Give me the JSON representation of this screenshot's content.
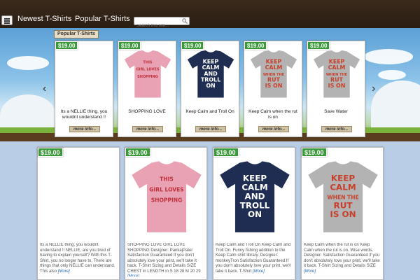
{
  "header": {
    "nav": [
      "Newest T-Shirts",
      "Popular T-Shirts"
    ],
    "search_placeholder": "Search this site..."
  },
  "slider": {
    "tag": "Popular T-Shirts",
    "prev": "‹",
    "next": "›",
    "items": [
      {
        "price": "$19.00",
        "title": "Its a NELLIE thing, you wouldnt understand !!",
        "more": "more info...",
        "shirt": "none"
      },
      {
        "price": "$19.00",
        "title": "SHOPPING LOVE",
        "more": "more info...",
        "shirt": "pink"
      },
      {
        "price": "$19.00",
        "title": "Keep Calm and Troll On",
        "more": "more info...",
        "shirt": "navy"
      },
      {
        "price": "$19.00",
        "title": "Keep Calm when the rut is on",
        "more": "more info...",
        "shirt": "grey"
      },
      {
        "price": "$19.00",
        "title": "Save Water",
        "more": "more info...",
        "shirt": "grey"
      }
    ]
  },
  "grid": [
    {
      "price": "$19.00",
      "desc": "Its a NELLIE thing, you wouldnt understand !! NELLIE, are you tired of having to explain yourself? With this T-Shirt, you no longer have to. There are things that only NELLIE can understand. This also",
      "more": "[More]",
      "shirt": "none"
    },
    {
      "price": "$19.00",
      "desc": "SHOPPING LOVE GIRL LOVE SHOPPING Designer: PankajPatel Satisfaction Guaranteed If you don't absolutely love your print, we'll take it back. T-Shirt Sizing and Details SIZE CHEST in LENGTH in S 18 28 M 20 29",
      "more": "[More]",
      "shirt": "pink"
    },
    {
      "price": "$19.00",
      "desc": "Keep Calm and Troll On Keep Calm and Troll On. Funny fishing addition to the Keep Calm shirt library. Designer: monkeyTron Satisfaction Guaranteed If you don't absolutely love your print, we'll take it back. T-Shirt",
      "more": "[More]",
      "shirt": "navy"
    },
    {
      "price": "$19.00",
      "desc": "Keep Calm when the rut is on Keep Calm when the rut is on. Wise words. Designer: Satisfaction Guaranteed If you don't absolutely love your print, we'll take it back. T-Shirt Sizing and Details SIZE",
      "more": "[More]",
      "shirt": "grey"
    }
  ],
  "shirt_art": {
    "pink": [
      "THIS",
      "GIRL LOVES",
      "SHOPPING"
    ],
    "navy": [
      "KEEP",
      "CALM",
      "AND",
      "TROLL",
      "ON"
    ],
    "grey": [
      "KEEP",
      "CALM",
      "WHEN THE",
      "RUT",
      "IS ON"
    ]
  },
  "colors": {
    "price_green": "#3a9a3a",
    "link_blue": "#2a6bbf",
    "pink_shirt": "#e8a2b4",
    "navy_shirt": "#1f2d52",
    "grey_shirt": "#b3b3b3"
  }
}
